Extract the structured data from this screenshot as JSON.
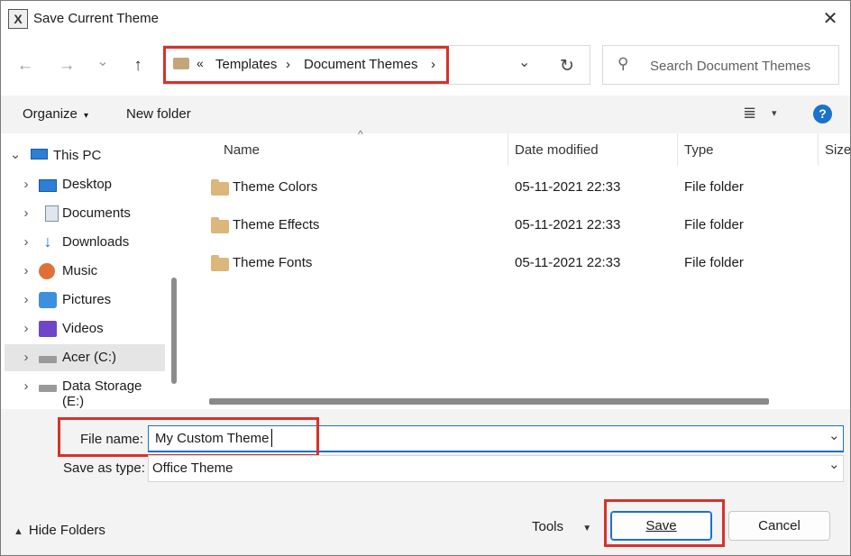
{
  "window": {
    "title": "Save Current Theme",
    "app_icon_glyph": "X",
    "close_glyph": "✕"
  },
  "nav": {
    "back_glyph": "←",
    "forward_glyph": "→",
    "recent_glyph": "⌄",
    "up_glyph": "↑"
  },
  "address": {
    "overflow_glyph": "«",
    "crumbs": [
      "Templates",
      "Document Themes"
    ],
    "separator_glyph": "›",
    "dropdown_glyph": "⌄",
    "refresh_glyph": "↻"
  },
  "search": {
    "placeholder": "Search Document Themes",
    "icon": "search-icon",
    "icon_glyph": "⚲"
  },
  "toolbar": {
    "organize": "Organize",
    "new_folder": "New folder",
    "view_glyph": "≣",
    "caret_glyph": "▾",
    "help_glyph": "?"
  },
  "nav_pane": {
    "root": {
      "label": "This PC",
      "expanded_glyph": "⌄"
    },
    "collapsed_glyph": "›",
    "items": [
      {
        "label": "Desktop",
        "icon": "desktop-icon"
      },
      {
        "label": "Documents",
        "icon": "documents-icon"
      },
      {
        "label": "Downloads",
        "icon": "downloads-icon",
        "glyph": "↓"
      },
      {
        "label": "Music",
        "icon": "music-icon"
      },
      {
        "label": "Pictures",
        "icon": "pictures-icon"
      },
      {
        "label": "Videos",
        "icon": "videos-icon"
      },
      {
        "label": "Acer (C:)",
        "icon": "drive-icon",
        "selected": true
      },
      {
        "label": "Data Storage (E:)",
        "icon": "drive-icon"
      }
    ]
  },
  "file_list": {
    "sort_glyph": "^",
    "columns": [
      "Name",
      "Date modified",
      "Type",
      "Size"
    ],
    "rows": [
      {
        "name": "Theme Colors",
        "date": "05-11-2021 22:33",
        "type": "File folder"
      },
      {
        "name": "Theme Effects",
        "date": "05-11-2021 22:33",
        "type": "File folder"
      },
      {
        "name": "Theme Fonts",
        "date": "05-11-2021 22:33",
        "type": "File folder"
      }
    ]
  },
  "form": {
    "file_name_label": "File name:",
    "file_name_value": "My Custom Theme",
    "save_type_label": "Save as type:",
    "save_type_value": "Office Theme",
    "dropdown_glyph": "⌄"
  },
  "footer": {
    "hide_folders": "Hide Folders",
    "hide_glyph": "▲",
    "tools": "Tools",
    "tools_caret": "▼",
    "save": "Save",
    "cancel": "Cancel"
  },
  "colors": {
    "highlight_red": "#d8312b",
    "accent_blue": "#1a72c9",
    "folder_tan": "#dcb67a",
    "selected_row": "#e5e5e5"
  }
}
